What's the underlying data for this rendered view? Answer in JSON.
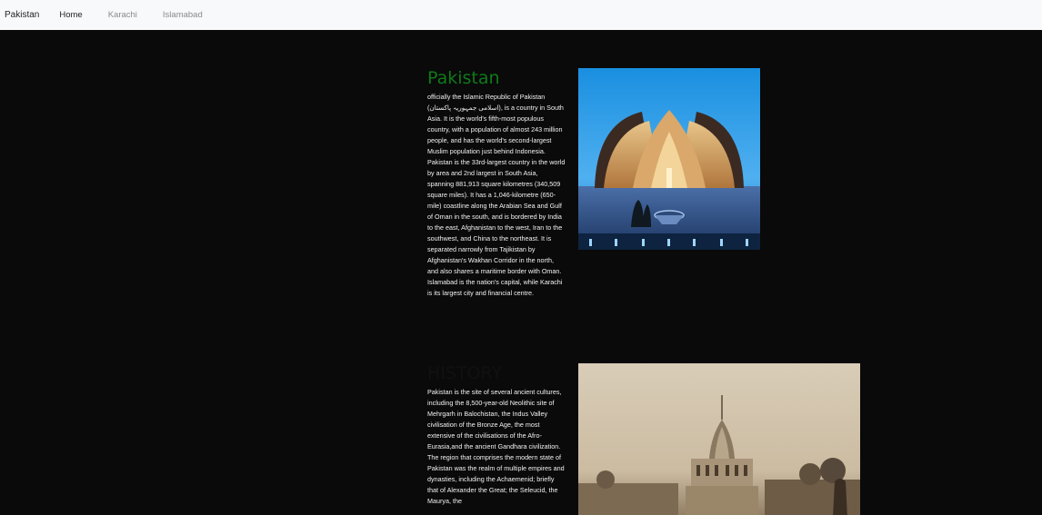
{
  "navbar": {
    "brand": "Pakistan",
    "links": [
      {
        "label": "Home"
      },
      {
        "label": "Karachi"
      },
      {
        "label": "Islamabad"
      }
    ]
  },
  "sections": [
    {
      "title": "Pakistan",
      "body": "officially the Islamic Republic of Pakistan (اسلامی جمہوریہ پاكستان), is a country in South Asia. It is the world's fifth-most populous country, with a population of almost 243 million people, and has the world's second-largest Muslim population just behind Indonesia. Pakistan is the 33rd-largest country in the world by area and 2nd largest in South Asia, spanning 881,913 square kilometres (340,509 square miles). It has a 1,046-kilometre (650-mile) coastline along the Arabian Sea and Gulf of Oman in the south, and is bordered by India to the east, Afghanistan to the west, Iran to the southwest, and China to the northeast. It is separated narrowly from Tajikistan by Afghanistan's Wakhan Corridor in the north, and also shares a maritime border with Oman. Islamabad is the nation's capital, while Karachi is its largest city and financial centre."
    },
    {
      "title": "HISTORY",
      "body": "Pakistan is the site of several ancient cultures, including the 8,500-year-old Neolithic site of Mehrgarh in Balochistan, the Indus Valley civilisation of the Bronze Age, the most extensive of the civilisations of the Afro-Eurasia,and the ancient Gandhara civilization. The region that comprises the modern state of Pakistan was the realm of multiple empires and dynasties, including the Achaemenid; briefly that of Alexander the Great; the Seleucid, the Maurya, the"
    }
  ],
  "colors": {
    "navbar_bg": "#f8f9fa",
    "page_bg": "#0a0a0a",
    "pakistan_title": "#0f7a1a",
    "history_title": "#111111",
    "body_text": "#f2f2f2"
  },
  "icons": {
    "pakistan_image": "pakistan-monument-photo",
    "history_image": "historic-temple-photo"
  }
}
